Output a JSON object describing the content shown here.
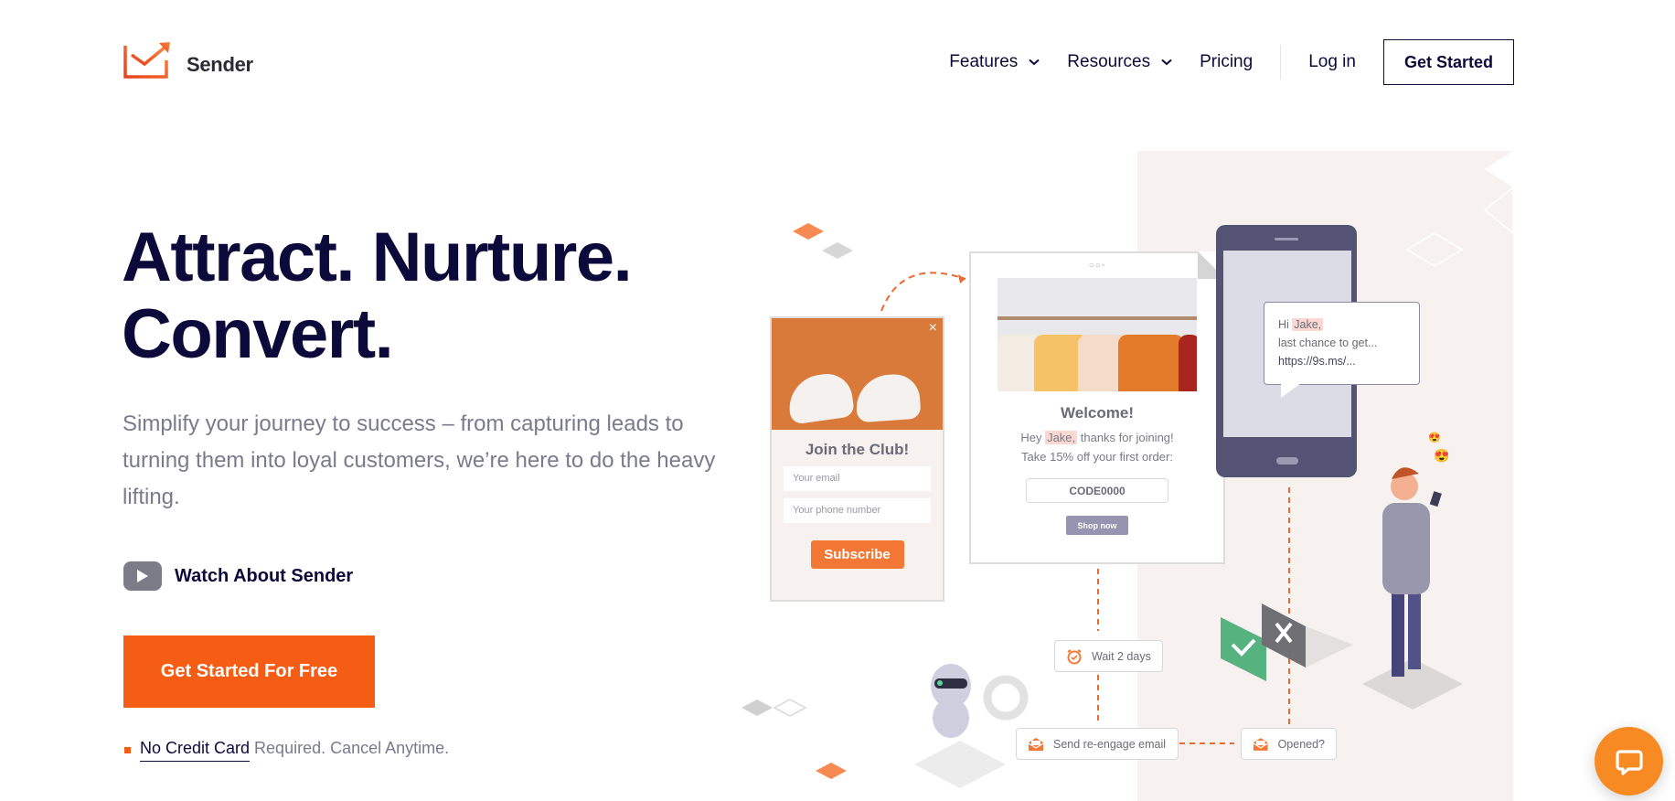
{
  "brand": {
    "name": "Sender",
    "accent": "#f65d14",
    "navy": "#0b0a3a"
  },
  "nav": {
    "items": [
      {
        "label": "Features",
        "has_dropdown": true
      },
      {
        "label": "Resources",
        "has_dropdown": true
      },
      {
        "label": "Pricing",
        "has_dropdown": false
      }
    ],
    "login": "Log in",
    "get_started": "Get Started"
  },
  "hero": {
    "title_line1": "Attract. Nurture.",
    "title_line2": "Convert.",
    "subtitle": "Simplify your journey to success – from capturing leads to turning them into loyal customers, we’re here to do the heavy lifting.",
    "watch_label": "Watch About Sender",
    "cta": "Get Started For Free",
    "note_link": "No Credit Card",
    "note_rest": "Required. Cancel Anytime."
  },
  "illustration": {
    "popup": {
      "title": "Join the Club!",
      "email_placeholder": "Your email",
      "phone_placeholder": "Your phone number",
      "button": "Subscribe",
      "close": "×"
    },
    "email": {
      "dots": "○○◦",
      "title": "Welcome!",
      "line1_pre": "Hey ",
      "line1_name": "Jake,",
      "line1_post": " thanks for joining!",
      "line2": "Take 15% off your first order:",
      "code": "CODE0000",
      "button": "Shop now"
    },
    "sms": {
      "greeting": "Hi ",
      "name": "Jake,",
      "line2": "last chance to get...",
      "link": "https://9s.ms/..."
    },
    "flow": {
      "wait": "Wait 2 days",
      "send": "Send re-engage email",
      "opened": "Opened?"
    }
  },
  "chat": {
    "icon": "chat-bubble-icon"
  }
}
